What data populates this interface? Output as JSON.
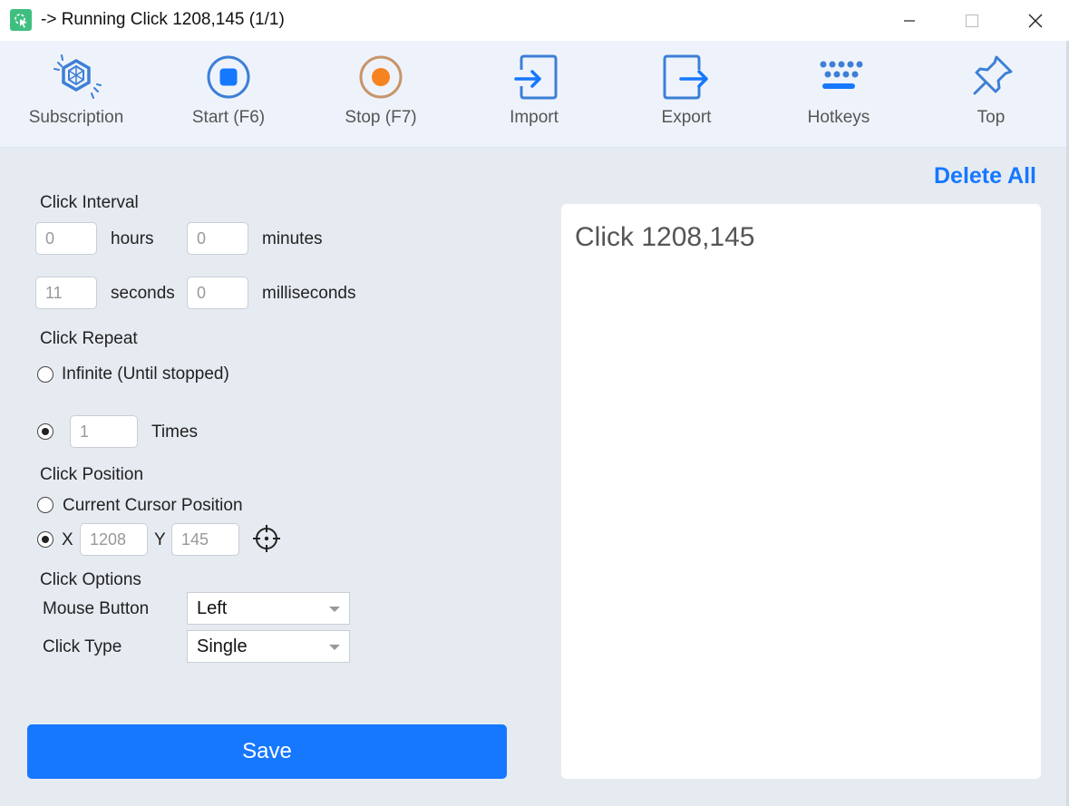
{
  "window": {
    "title": "-> Running Click 1208,145 (1/1)",
    "icon": "app-cursor-icon",
    "controls": [
      "minimize",
      "maximize",
      "close"
    ]
  },
  "toolbar": {
    "items": [
      {
        "label": "Subscription",
        "icon": "diamond-icon"
      },
      {
        "label": "Start (F6)",
        "icon": "start-icon"
      },
      {
        "label": "Stop (F7)",
        "icon": "stop-record-icon"
      },
      {
        "label": "Import",
        "icon": "import-icon"
      },
      {
        "label": "Export",
        "icon": "export-icon"
      },
      {
        "label": "Hotkeys",
        "icon": "keyboard-icon"
      },
      {
        "label": "Top",
        "icon": "pin-icon"
      }
    ]
  },
  "form": {
    "click_interval": {
      "heading": "Click Interval",
      "hours": {
        "value": "0",
        "unit": "hours"
      },
      "minutes": {
        "value": "0",
        "unit": "minutes"
      },
      "seconds": {
        "value": "11",
        "unit": "seconds"
      },
      "milliseconds": {
        "value": "0",
        "unit": "milliseconds"
      }
    },
    "click_repeat": {
      "heading": "Click Repeat",
      "infinite_label": "Infinite (Until stopped)",
      "times_value": "1",
      "times_label": "Times",
      "selected": "times"
    },
    "click_position": {
      "heading": "Click Position",
      "cursor_label": "Current Cursor Position",
      "x_label": "X",
      "x_value": "1208",
      "y_label": "Y",
      "y_value": "145",
      "selected": "xy"
    },
    "click_options": {
      "heading": "Click Options",
      "mouse_button_label": "Mouse Button",
      "mouse_button_value": "Left",
      "click_type_label": "Click Type",
      "click_type_value": "Single"
    },
    "save_label": "Save"
  },
  "tasks": {
    "delete_all_label": "Delete All",
    "items": [
      "Click 1208,145"
    ]
  },
  "colors": {
    "accent": "#1677ff",
    "toolbar_icon": "#3d7fd6",
    "stop_ring": "#c8956a",
    "stop_dot": "#f5831f",
    "app_icon": "#3fbf7f"
  }
}
